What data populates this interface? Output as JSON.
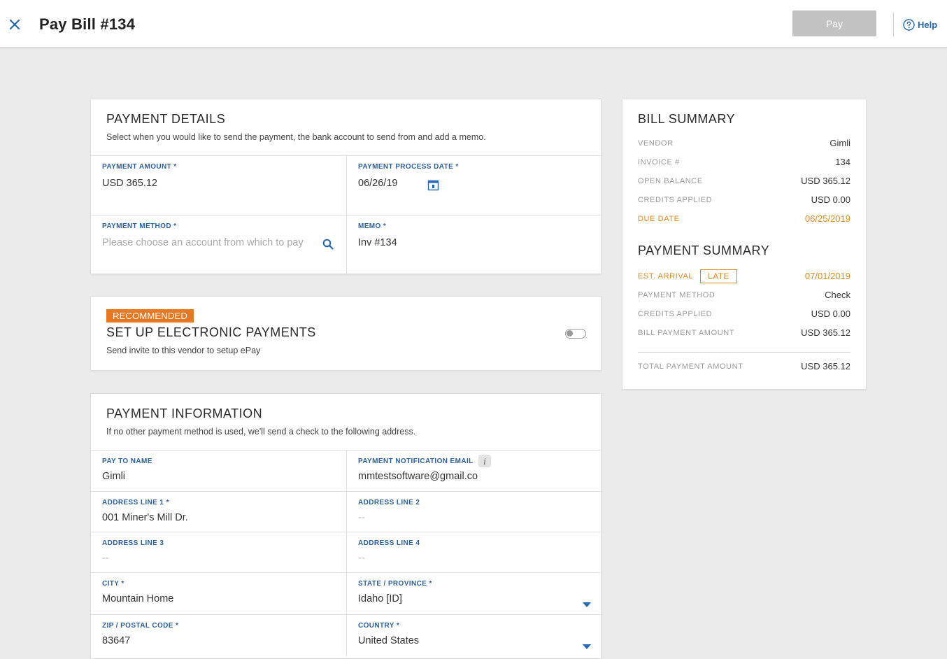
{
  "header": {
    "title": "Pay Bill #134",
    "pay_label": "Pay",
    "help_label": "Help"
  },
  "payment_details": {
    "title": "PAYMENT DETAILS",
    "subtitle": "Select when you would like to send the payment, the bank account to send from and add a memo.",
    "amount_label": "PAYMENT AMOUNT *",
    "amount_value": "USD 365.12",
    "date_label": "PAYMENT PROCESS DATE *",
    "date_value": "06/26/19",
    "method_label": "PAYMENT METHOD *",
    "method_placeholder": "Please choose an account from which to pay",
    "memo_label": "MEMO *",
    "memo_value": "Inv #134"
  },
  "epay": {
    "badge": "RECOMMENDED",
    "title": "SET UP ELECTRONIC PAYMENTS",
    "subtitle": "Send invite to this vendor to setup ePay"
  },
  "payment_info": {
    "title": "PAYMENT INFORMATION",
    "subtitle": "If no other payment method is used, we'll send a check to the following address.",
    "pay_to_name_label": "PAY TO NAME",
    "pay_to_name_value": "Gimli",
    "email_label": "PAYMENT NOTIFICATION EMAIL",
    "email_value": "mmtestsoftware@gmail.com",
    "address1_label": "ADDRESS LINE 1 *",
    "address1_value": "001 Miner's Mill Dr.",
    "address2_label": "ADDRESS LINE 2",
    "address2_value": "--",
    "address3_label": "ADDRESS LINE 3",
    "address3_value": "--",
    "address4_label": "ADDRESS LINE 4",
    "address4_value": "--",
    "city_label": "CITY *",
    "city_value": "Mountain Home",
    "state_label": "STATE / PROVINCE *",
    "state_value": "Idaho [ID]",
    "zip_label": "ZIP / POSTAL CODE *",
    "zip_value": "83647",
    "country_label": "COUNTRY *",
    "country_value": "United States"
  },
  "bill_summary": {
    "title": "BILL SUMMARY",
    "rows": [
      {
        "label": "VENDOR",
        "value": "Gimli"
      },
      {
        "label": "INVOICE #",
        "value": "134"
      },
      {
        "label": "OPEN BALANCE",
        "value": "USD 365.12"
      },
      {
        "label": "CREDITS APPLIED",
        "value": "USD 0.00"
      },
      {
        "label": "DUE DATE",
        "value": "06/25/2019"
      }
    ]
  },
  "payment_summary": {
    "title": "PAYMENT SUMMARY",
    "est_arrival_label": "EST. ARRIVAL",
    "late_badge": "LATE",
    "est_arrival_value": "07/01/2019",
    "rows": [
      {
        "label": "PAYMENT METHOD",
        "value": "Check"
      },
      {
        "label": "CREDITS APPLIED",
        "value": "USD 0.00"
      },
      {
        "label": "BILL PAYMENT AMOUNT",
        "value": "USD 365.12"
      }
    ],
    "total_label": "TOTAL PAYMENT AMOUNT",
    "total_value": "USD 365.12"
  },
  "colors": {
    "accent_blue": "#2467b0",
    "warning_orange": "#e08a1e",
    "badge_orange": "#e87722",
    "disabled_gray": "#c2c2c2"
  }
}
